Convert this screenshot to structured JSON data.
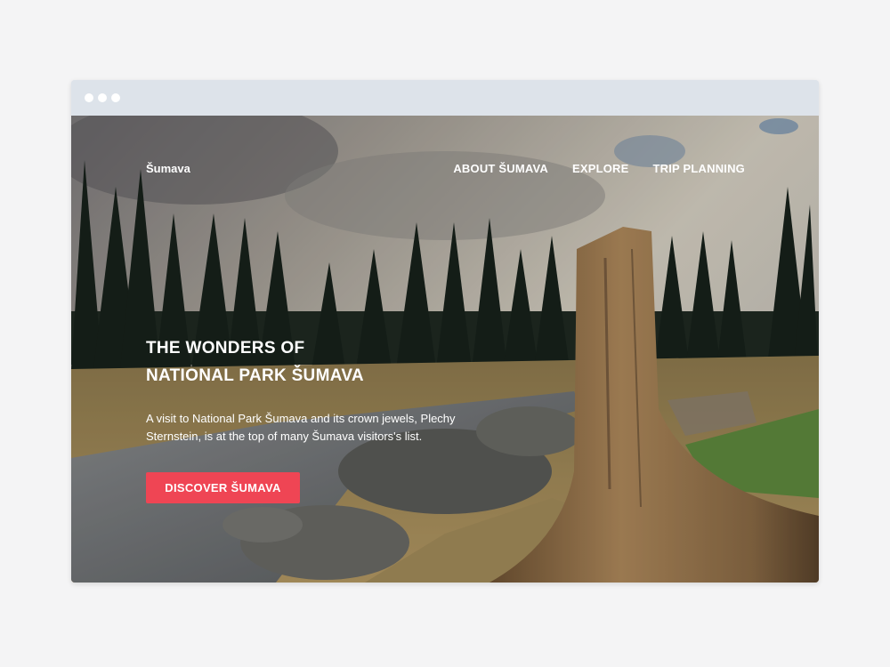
{
  "window": {
    "dots": [
      "dot",
      "dot",
      "dot"
    ]
  },
  "header": {
    "logo": "Šumava",
    "nav": [
      {
        "label": "ABOUT ŠUMAVA"
      },
      {
        "label": "EXPLORE"
      },
      {
        "label": "TRIP PLANNING"
      }
    ]
  },
  "hero": {
    "headline_line1": "THE WONDERS OF",
    "headline_line2": "NATIONAL PARK ŠUMAVA",
    "lead": "A visit to National Park Šumava and its crown jewels, Plechy Sternstein, is at the top of many Šumava visitors's list.",
    "cta_label": "DISCOVER ŠUMAVA",
    "background": "forest river landscape with a dead tree stump",
    "colors": {
      "accent": "#ef4554",
      "chrome": "#dde3ea",
      "page": "#f4f4f5"
    }
  }
}
